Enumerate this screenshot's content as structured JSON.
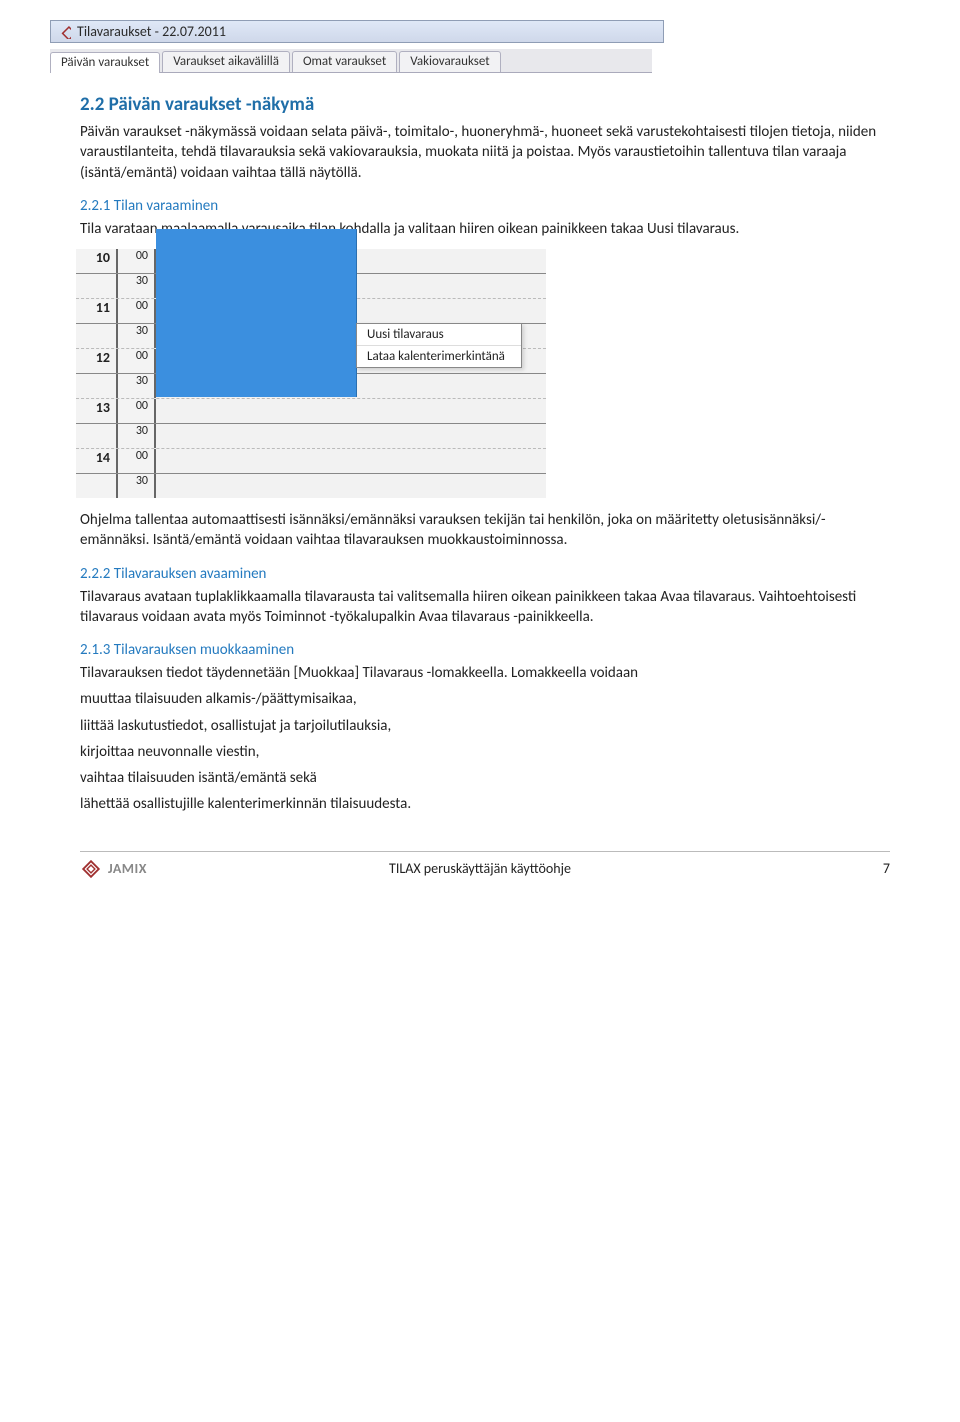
{
  "window": {
    "title": "Tilavaraukset - 22.07.2011",
    "tabs": [
      {
        "label": "Päivän varaukset",
        "active": true
      },
      {
        "label": "Varaukset aikavälillä"
      },
      {
        "label": "Omat varaukset"
      },
      {
        "label": "Vakiovaraukset"
      }
    ]
  },
  "sections": {
    "h22": "2.2 Päivän varaukset -näkymä",
    "p22": "Päivän varaukset -näkymässä voidaan selata päivä-, toimitalo-, huoneryhmä-, huoneet sekä varustekohtaisesti tilojen tietoja, niiden varaustilanteita, tehdä tilavarauksia sekä vakiovarauksia, muokata niitä ja poistaa. Myös varaustietoihin tallentuva tilan varaaja (isäntä/emäntä) voidaan vaihtaa tällä näytöllä.",
    "h221": "2.2.1 Tilan varaaminen",
    "p221": "Tila varataan maalaamalla varausaika tilan kohdalla ja valitaan hiiren oikean painikkeen takaa Uusi tilavaraus.",
    "p_after_cal": "Ohjelma tallentaa automaattisesti isännäksi/emännäksi varauksen tekijän tai henkilön, joka on määritetty oletusisännäksi/-emännäksi. Isäntä/emäntä voidaan vaihtaa tilavarauksen muokkaustoiminnossa.",
    "h222": "2.2.2 Tilavarauksen avaaminen",
    "p222": "Tilavaraus avataan tuplaklikkaamalla tilavarausta tai valitsemalla hiiren oikean painikkeen takaa Avaa tilavaraus. Vaihtoehtoisesti tilavaraus voidaan avata myös Toiminnot -työkalupalkin Avaa tilavaraus -painikkeella.",
    "h213": "2.1.3 Tilavarauksen muokkaaminen",
    "p213a": "Tilavarauksen tiedot täydennetään [Muokkaa] Tilavaraus -lomakkeella. Lomakkeella voidaan",
    "bullets": [
      "muuttaa tilaisuuden alkamis-/päättymisaikaa,",
      "liittää laskutustiedot, osallistujat ja tarjoilutilauksia,",
      "kirjoittaa neuvonnalle viestin,",
      "vaihtaa tilaisuuden isäntä/emäntä sekä",
      "lähettää osallistujille kalenterimerkinnän tilaisuudesta."
    ]
  },
  "calendar": {
    "hours": [
      "10",
      "11",
      "12",
      "13",
      "14"
    ],
    "sub": "30",
    "top": "00",
    "context_menu": [
      "Uusi tilavaraus",
      "Lataa kalenterimerkintänä"
    ]
  },
  "footer": {
    "logo_text": "JAMIX",
    "center": "TILAX peruskäyttäjän käyttöohje",
    "page": "7"
  }
}
